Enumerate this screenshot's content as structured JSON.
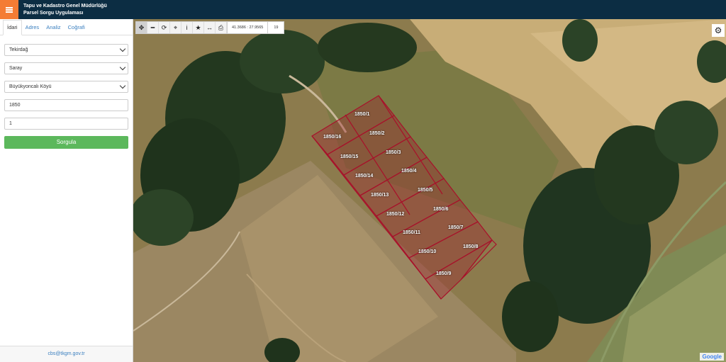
{
  "header": {
    "title_line1": "Tapu ve Kadastro Genel Müdürlüğü",
    "title_line2": "Parsel Sorgu Uygulaması"
  },
  "sidebar": {
    "tabs": [
      "İdari",
      "Adres",
      "Analiz",
      "Coğrafi"
    ],
    "province": "Tekirdağ",
    "district": "Saray",
    "neighborhood": "Büyükyoncalı Köyü",
    "block": "1850",
    "parcel": "1",
    "submit_label": "Sorgula",
    "footer_email": "cbs@tkgm.gov.tr"
  },
  "toolbar": {
    "coordinates": "41.3686 : 27.9565",
    "zoom": "19"
  },
  "map": {
    "attribution": "Google",
    "parcels": [
      "1850/1",
      "1850/2",
      "1850/3",
      "1850/4",
      "1850/5",
      "1850/6",
      "1850/7",
      "1850/8",
      "1850/9",
      "1850/10",
      "1850/11",
      "1850/12",
      "1850/13",
      "1850/14",
      "1850/15",
      "1850/16"
    ]
  }
}
